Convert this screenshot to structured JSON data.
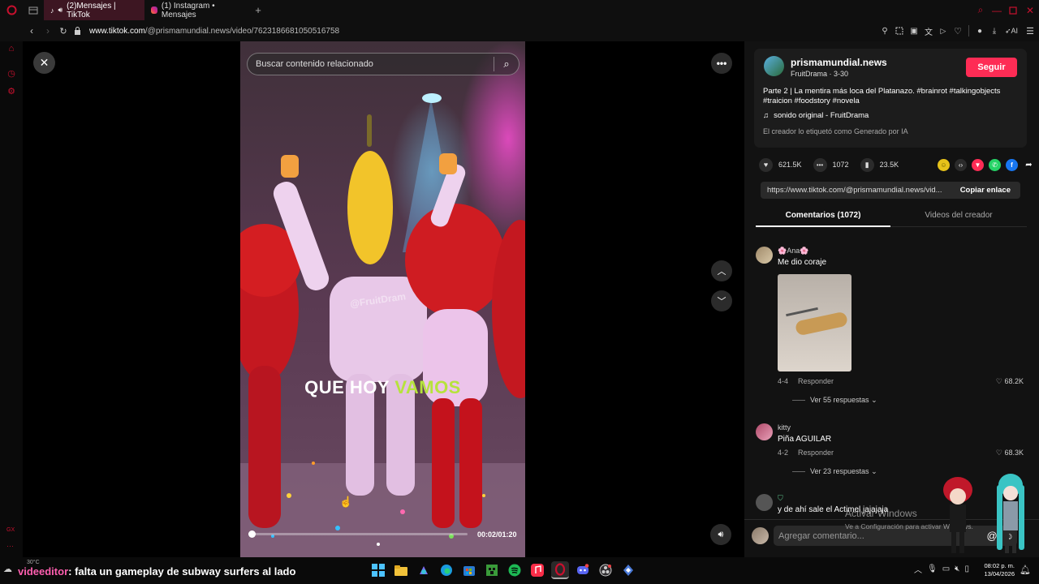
{
  "tabs": [
    {
      "label": "(2)Mensajes | TikTok",
      "active": true
    },
    {
      "label": "(1) Instagram • Mensajes",
      "active": false
    }
  ],
  "address": {
    "url_domain": "www.tiktok.com",
    "url_path": "/@prismamundial.news/video/7623186681050516758"
  },
  "toolbar": {
    "ai_label": "AI"
  },
  "video": {
    "search_placeholder": "Buscar contenido relacionado",
    "watermark": "@FruitDram",
    "caption_white": "QUE HOY",
    "caption_green": "VAMOS",
    "time": "00:02/01:20",
    "progress": 0.025
  },
  "creator": {
    "name": "prismamundial.news",
    "sub": "FruitDrama · 3-30",
    "follow": "Seguir",
    "description": "Parte 2 | La mentira más loca del Platanazo. #brainrot #talkingobjects #traicion #foodstory #novela",
    "sound": "sonido original - FruitDrama",
    "ai_label": "El creador lo etiquetó como Generado por IA"
  },
  "stats": {
    "likes": "621.5K",
    "comments": "1072",
    "saves": "23.5K"
  },
  "link": {
    "url": "https://www.tiktok.com/@prismamundial.news/vid...",
    "copy": "Copiar enlace"
  },
  "tabs_panel": {
    "comments": "Comentarios (1072)",
    "creator_videos": "Videos del creador"
  },
  "comments": [
    {
      "name": "🌸Ana🌸",
      "text": "Me dio coraje",
      "date": "4-4",
      "reply": "Responder",
      "likes": "68.2K",
      "replies": "Ver 55 respuestas"
    },
    {
      "name": "kitty",
      "text": "Piña AGUILAR",
      "date": "4-2",
      "reply": "Responder",
      "likes": "68.3K",
      "replies": "Ver 23 respuestas"
    },
    {
      "name": "",
      "text": "y de ahí sale el Actimel jajajaja"
    }
  ],
  "comment_input": {
    "placeholder": "Agregar comentario..."
  },
  "overlay": {
    "activate_title": "Activar Windows",
    "activate_sub": "Ve a Configuración para activar Windows."
  },
  "taskbar": {
    "stream_user": "videeditor",
    "stream_msg": ": falta un gameplay de subway surfers al lado",
    "weather": "30°C",
    "clock_time": "08:02 p. m.",
    "clock_date": "13/04/2026",
    "sidebar_badge": "GX"
  },
  "colors": {
    "accent": "#fe2c55",
    "browser_red": "#c8102e",
    "caption_green": "#b6e33c"
  }
}
